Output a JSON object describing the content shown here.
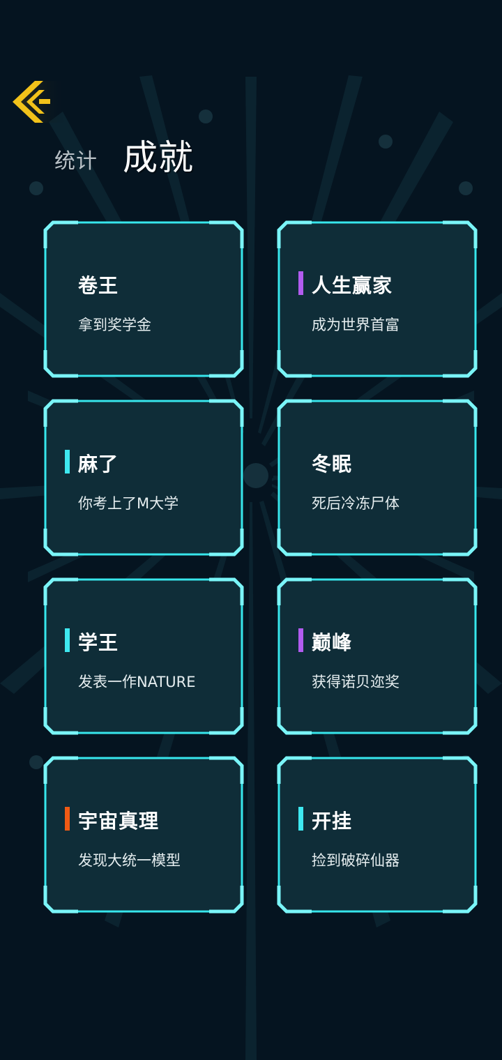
{
  "header": {
    "tab_stats": "统计",
    "tab_achievements": "成就"
  },
  "colors": {
    "background": "#051420",
    "card_fill": "#0f2d38",
    "card_border": "#37e6ec",
    "rarity_cyan": "#3ee8f0",
    "rarity_purple": "#b25cf0",
    "rarity_orange": "#f05a14",
    "back_icon": "#f2c21a"
  },
  "achievements": [
    {
      "title": "卷王",
      "desc": "拿到奖学金",
      "rarity": "none"
    },
    {
      "title": "人生赢家",
      "desc": "成为世界首富",
      "rarity": "purple"
    },
    {
      "title": "麻了",
      "desc": "你考上了M大学",
      "rarity": "cyan"
    },
    {
      "title": "冬眠",
      "desc": "死后冷冻尸体",
      "rarity": "none"
    },
    {
      "title": "学王",
      "desc": "发表一作NATURE",
      "rarity": "cyan"
    },
    {
      "title": "巅峰",
      "desc": "获得诺贝迩奖",
      "rarity": "purple"
    },
    {
      "title": "宇宙真理",
      "desc": "发现大统一模型",
      "rarity": "orange"
    },
    {
      "title": "开挂",
      "desc": "捡到破碎仙器",
      "rarity": "cyan"
    }
  ]
}
